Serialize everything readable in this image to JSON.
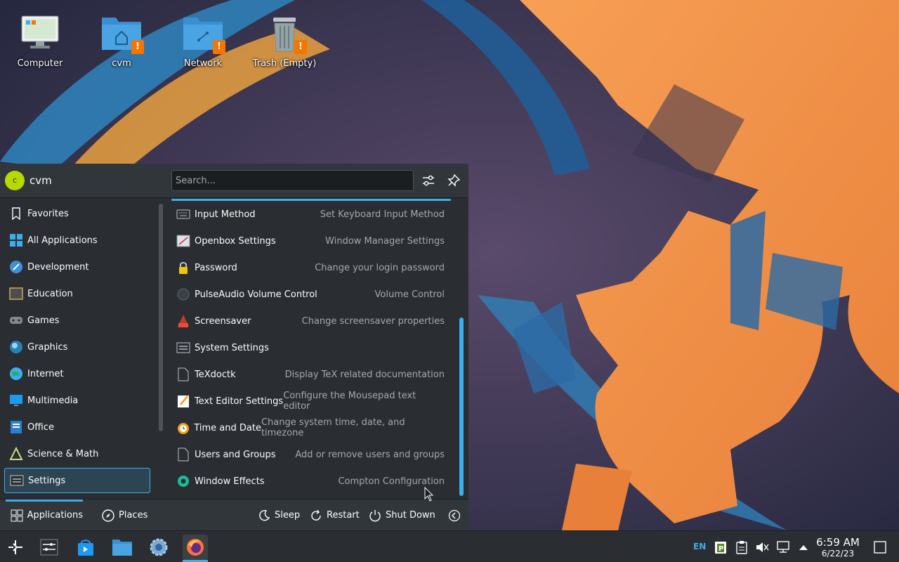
{
  "desktop": {
    "icons": [
      {
        "label": "Computer",
        "icon": "computer-icon"
      },
      {
        "label": "cvm",
        "icon": "home-folder-icon"
      },
      {
        "label": "Network",
        "icon": "network-folder-icon"
      },
      {
        "label": "Trash (Empty)",
        "icon": "trash-icon"
      }
    ]
  },
  "launcher": {
    "user": {
      "initial": "c",
      "name": "cvm"
    },
    "search": {
      "placeholder": "Search..."
    },
    "categories": [
      {
        "label": "Favorites",
        "icon": "bookmark-icon"
      },
      {
        "label": "All Applications",
        "icon": "grid-icon"
      },
      {
        "label": "Development",
        "icon": "development-icon"
      },
      {
        "label": "Education",
        "icon": "education-icon"
      },
      {
        "label": "Games",
        "icon": "gamepad-icon"
      },
      {
        "label": "Graphics",
        "icon": "graphics-icon"
      },
      {
        "label": "Internet",
        "icon": "globe-icon"
      },
      {
        "label": "Multimedia",
        "icon": "multimedia-icon"
      },
      {
        "label": "Office",
        "icon": "office-icon"
      },
      {
        "label": "Science & Math",
        "icon": "science-icon"
      },
      {
        "label": "Settings",
        "icon": "settings-icon",
        "active": true
      }
    ],
    "apps": [
      {
        "name": "Input Method",
        "desc": "Set Keyboard Input Method",
        "icon": "keyboard-icon"
      },
      {
        "name": "Openbox Settings",
        "desc": "Window Manager Settings",
        "icon": "openbox-icon"
      },
      {
        "name": "Password",
        "desc": "Change your login password",
        "icon": "lock-icon"
      },
      {
        "name": "PulseAudio Volume Control",
        "desc": "Volume Control",
        "icon": "speaker-icon"
      },
      {
        "name": "Screensaver",
        "desc": "Change screensaver properties",
        "icon": "screensaver-icon"
      },
      {
        "name": "System Settings",
        "desc": "",
        "icon": "system-settings-icon"
      },
      {
        "name": "TeXdoctk",
        "desc": "Display TeX related documentation",
        "icon": "document-icon"
      },
      {
        "name": "Text Editor Settings",
        "desc": "Configure the Mousepad text editor",
        "icon": "text-editor-icon"
      },
      {
        "name": "Time and Date",
        "desc": "Change system time, date, and timezone",
        "icon": "clock-icon"
      },
      {
        "name": "Users and Groups",
        "desc": "Add or remove users and groups",
        "icon": "document-icon"
      },
      {
        "name": "Window Effects",
        "desc": "Compton Configuration",
        "icon": "gear-icon"
      }
    ],
    "footer": {
      "applications": "Applications",
      "places": "Places",
      "sleep": "Sleep",
      "restart": "Restart",
      "shutdown": "Shut Down"
    }
  },
  "taskbar": {
    "language": "EN",
    "time": "6:59 AM",
    "date": "6/22/23"
  },
  "colors": {
    "accent": "#3daee9",
    "panel_bg": "#2a2e32",
    "header_bg": "#31363b",
    "warning": "#f67400"
  }
}
